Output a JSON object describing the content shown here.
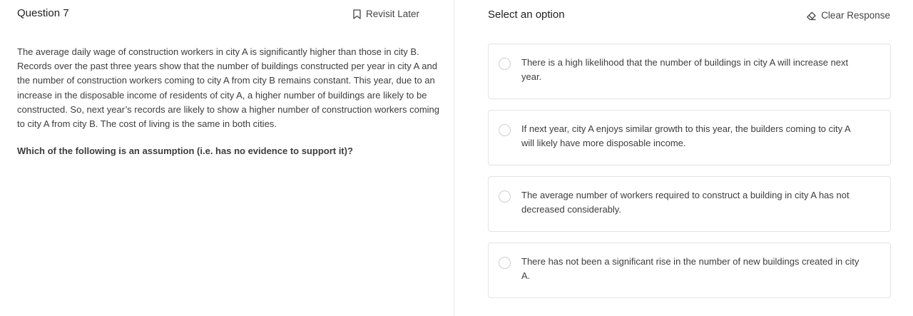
{
  "question": {
    "title": "Question 7",
    "revisit_label": "Revisit Later",
    "passage": "The average daily wage of construction workers in city A is significantly higher than those in city B. Records over the past three years show that the number of buildings constructed per year in city A and the number of construction workers coming to city A from city B remains constant. This year, due to an increase in the disposable income of residents of city A, a higher number of buildings are likely to be constructed. So, next year’s records are likely to show a higher number of construction workers coming to city A from city B. The cost of living is the same in both cities.",
    "prompt": "Which of the following is an assumption (i.e. has no evidence to support it)?"
  },
  "answer_panel": {
    "title": "Select an option",
    "clear_label": "Clear Response",
    "options": [
      {
        "text": "There is a high likelihood that the number of buildings in city A will increase next year."
      },
      {
        "text": "If next year, city A enjoys similar growth to this year, the builders coming to city A will likely have more disposable income."
      },
      {
        "text": "The average number of workers required to construct a building in city A has not decreased considerably."
      },
      {
        "text": "There has not been a significant rise in the number of new buildings created in city A."
      }
    ]
  },
  "icons": {
    "revisit": "bookmark-icon",
    "clear": "eraser-icon",
    "option": "radio-icon"
  },
  "colors": {
    "text": "#3d3d3d",
    "border": "#e3e3e3",
    "radio_border": "#cfcfcf"
  }
}
